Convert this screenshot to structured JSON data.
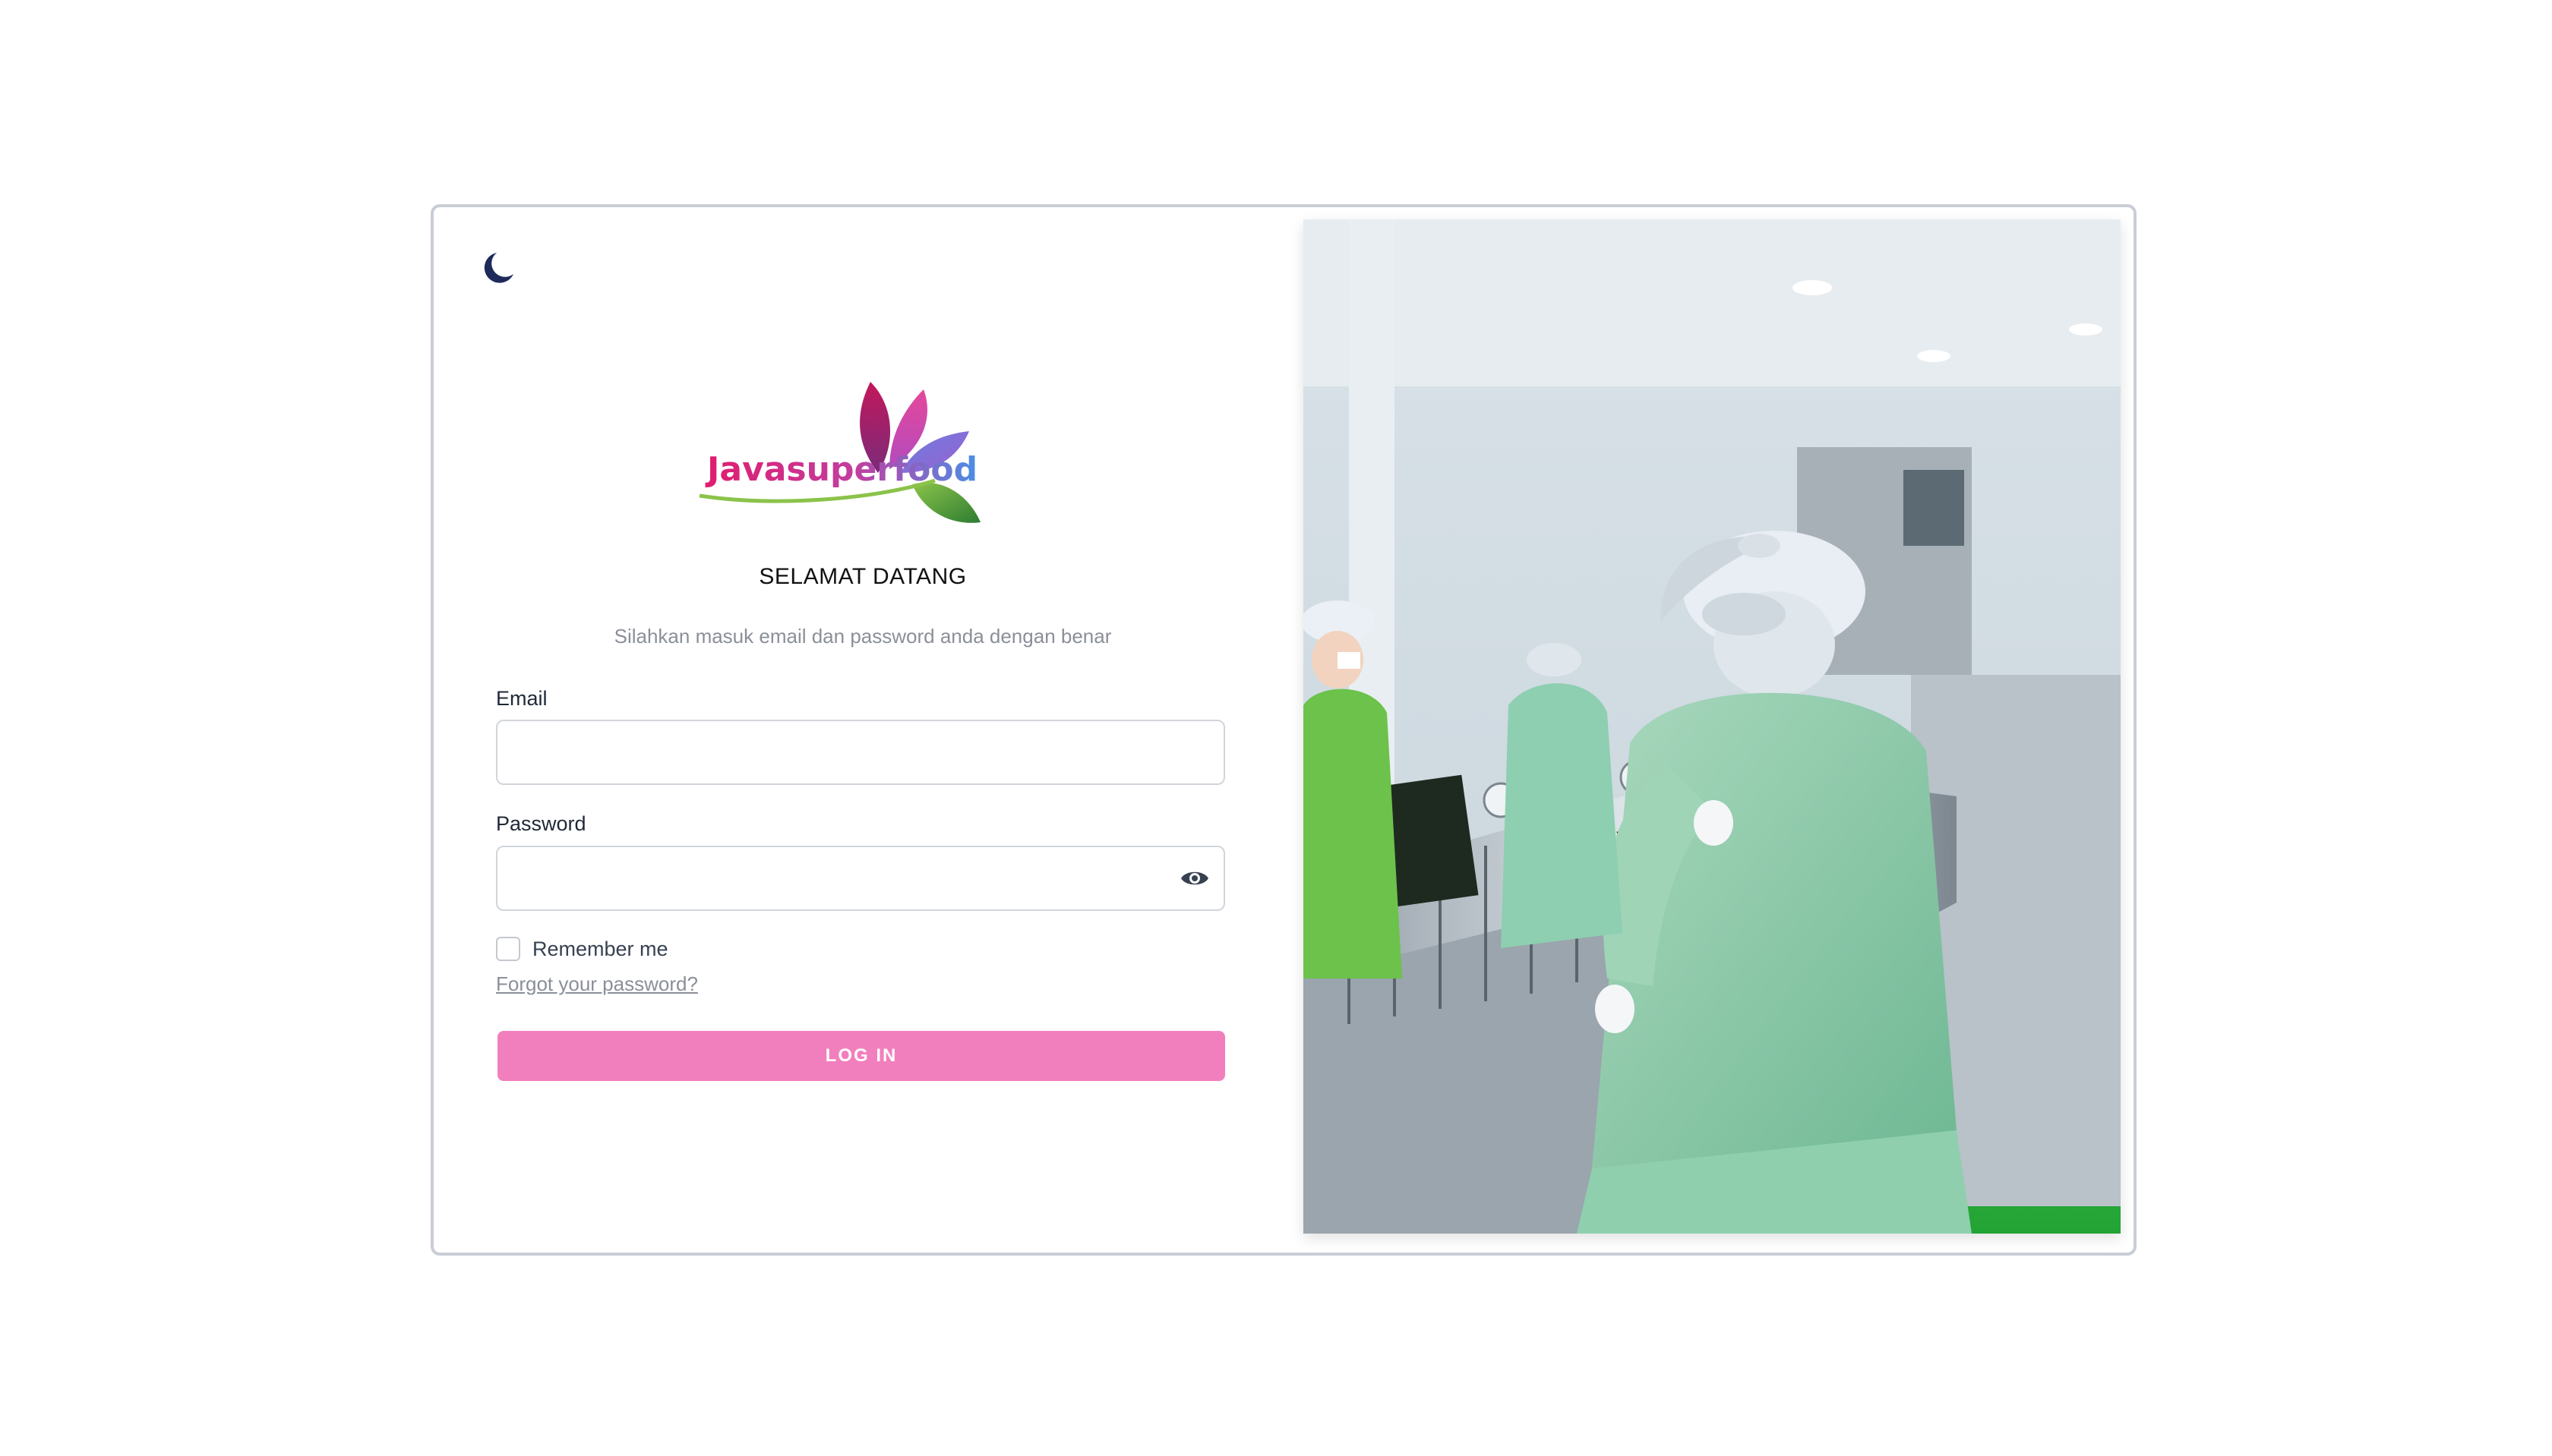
{
  "theme_toggle": {
    "icon": "moon-icon"
  },
  "logo": {
    "text": "Javasuperfood"
  },
  "heading": {
    "title": "SELAMAT DATANG",
    "subtitle": "Silahkan masuk email dan password anda dengan benar"
  },
  "form": {
    "email_label": "Email",
    "email_value": "",
    "email_placeholder": "",
    "password_label": "Password",
    "password_value": "",
    "password_placeholder": "",
    "remember_label": "Remember me",
    "remember_checked": false,
    "forgot_label": "Forgot your password?",
    "submit_label": "LOG IN"
  },
  "colors": {
    "primary_button": "#f27fbd",
    "moon_icon": "#1e2a5a",
    "border": "#c9cdd6"
  },
  "photo": {
    "icon": "factory-photo"
  }
}
